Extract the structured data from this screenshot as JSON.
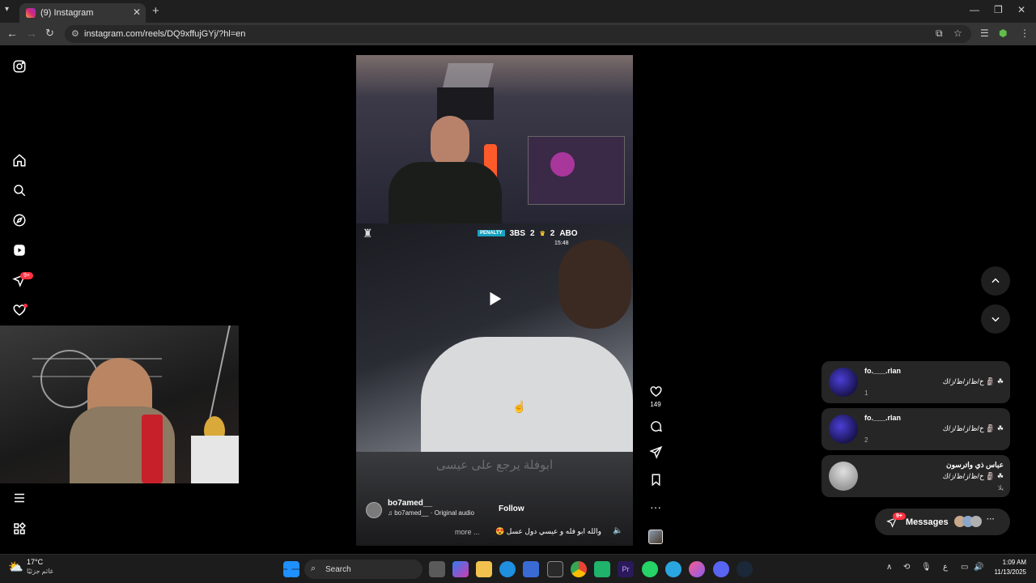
{
  "browser": {
    "tab_title": "(9) Instagram",
    "url": "instagram.com/reels/DQ9xffujGYj/?hl=en"
  },
  "reel": {
    "score_left_team": "3BS",
    "score_left": "2",
    "score_right": "2",
    "score_right_team": "ABO",
    "penalty_label": "PENALTY",
    "match_clock": "15:48",
    "subtitle_ar": "ابوفلة يرجع على عيسى",
    "username": "bo7amed__",
    "audio": "bo7amed__ · Original audio",
    "follow_label": "Follow",
    "caption": "والله ابو فله و عيسي دول عسل 😍",
    "more_label": "more ...",
    "like_count": "149"
  },
  "dms": [
    {
      "name": "fo.___.rlan",
      "message": "خ/ظ/ز/ظ/ز/ك 🗿 ☘",
      "sub": "1"
    },
    {
      "name": "fo.___.rlan",
      "message": "خ/ظ/ز/ظ/ز/ك 🗿 ☘",
      "sub": "2"
    },
    {
      "name": "عباس ذي واترسون",
      "message": "خ/ظ/ز/ظ/ز/ك 🗿 ☘",
      "sub": "يلا"
    }
  ],
  "messages": {
    "label": "Messages",
    "badge": "9+"
  },
  "nav": {
    "notifications_badge": "9+"
  },
  "taskbar": {
    "temperature": "17°C",
    "weather_desc": "غائم جزئيًا",
    "search_label": "Search",
    "time": "1:09 AM",
    "date": "11/13/2025",
    "lang": "ع"
  }
}
